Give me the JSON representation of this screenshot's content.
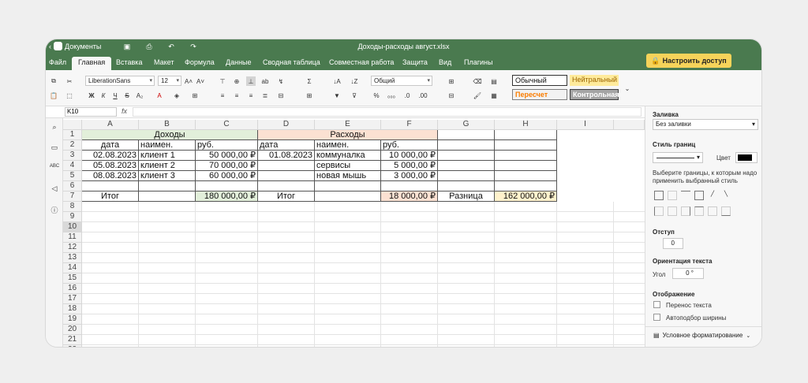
{
  "titlebar": {
    "app_name": "Документы",
    "file_name": "Доходы-расходы август.xlsx"
  },
  "tabs": [
    "Файл",
    "Главная",
    "Вставка",
    "Макет",
    "Формула",
    "Данные",
    "Сводная таблица",
    "Совместная работа",
    "Защита",
    "Вид",
    "Плагины"
  ],
  "active_tab": "Главная",
  "access_button": "Настроить доступ",
  "toolbar": {
    "font_name": "LiberationSans",
    "font_size": "12",
    "number_format": "Общий"
  },
  "cell_styles": {
    "normal": "Обычный",
    "neutral": "Нейтральный",
    "recalc": "Пересчет",
    "control": "Контрольная"
  },
  "formula_bar": {
    "cell_ref": "K10",
    "fx": "fx"
  },
  "columns": [
    "A",
    "B",
    "C",
    "D",
    "E",
    "F",
    "G",
    "H",
    "I"
  ],
  "rows": [
    "1",
    "2",
    "3",
    "4",
    "5",
    "6",
    "7",
    "8",
    "9",
    "10",
    "11",
    "12",
    "13",
    "14",
    "15",
    "16",
    "17",
    "18",
    "19",
    "20",
    "21",
    "22"
  ],
  "cells": {
    "A1": "Доходы",
    "D1": "Расходы",
    "A2": "дата",
    "B2": "наимен.",
    "C2": "руб.",
    "D2": "дата",
    "E2": "наимен.",
    "F2": "руб.",
    "A3": "02.08.2023",
    "B3": "клиент 1",
    "C3": "50 000,00 ₽",
    "D3": "01.08.2023",
    "E3": "коммуналка",
    "F3": "10 000,00 ₽",
    "A4": "05.08.2023",
    "B4": "клиент 2",
    "C4": "70 000,00 ₽",
    "E4": "сервисы",
    "F4": "5 000,00 ₽",
    "A5": "08.08.2023",
    "B5": "клиент 3",
    "C5": "60 000,00 ₽",
    "E5": "новая мышь",
    "F5": "3 000,00 ₽",
    "A7": "Итог",
    "C7": "180 000,00 ₽",
    "D7": "Итог",
    "F7": "18 000,00 ₽",
    "G7": "Разница",
    "H7": "162 000,00 ₽"
  },
  "side_panel": {
    "fill_label": "Заливка",
    "fill_value": "Без заливки",
    "border_style_label": "Стиль границ",
    "color_label": "Цвет",
    "border_hint": "Выберите границы, к которым надо применить выбранный стиль",
    "indent_label": "Отступ",
    "indent_value": "0",
    "orientation_label": "Ориентация текста",
    "angle_label": "Угол",
    "angle_value": "0 °",
    "display_label": "Отображение",
    "wrap_text": "Перенос текста",
    "autofit": "Автоподбор ширины",
    "conditional": "Условное форматирование"
  },
  "colors": {
    "header_green": "#4a7a4f",
    "accent_yellow": "#f6d35a",
    "income_fill": "#e2efda",
    "expense_fill": "#fbe1d2",
    "total_fill": "#fff2cc"
  }
}
